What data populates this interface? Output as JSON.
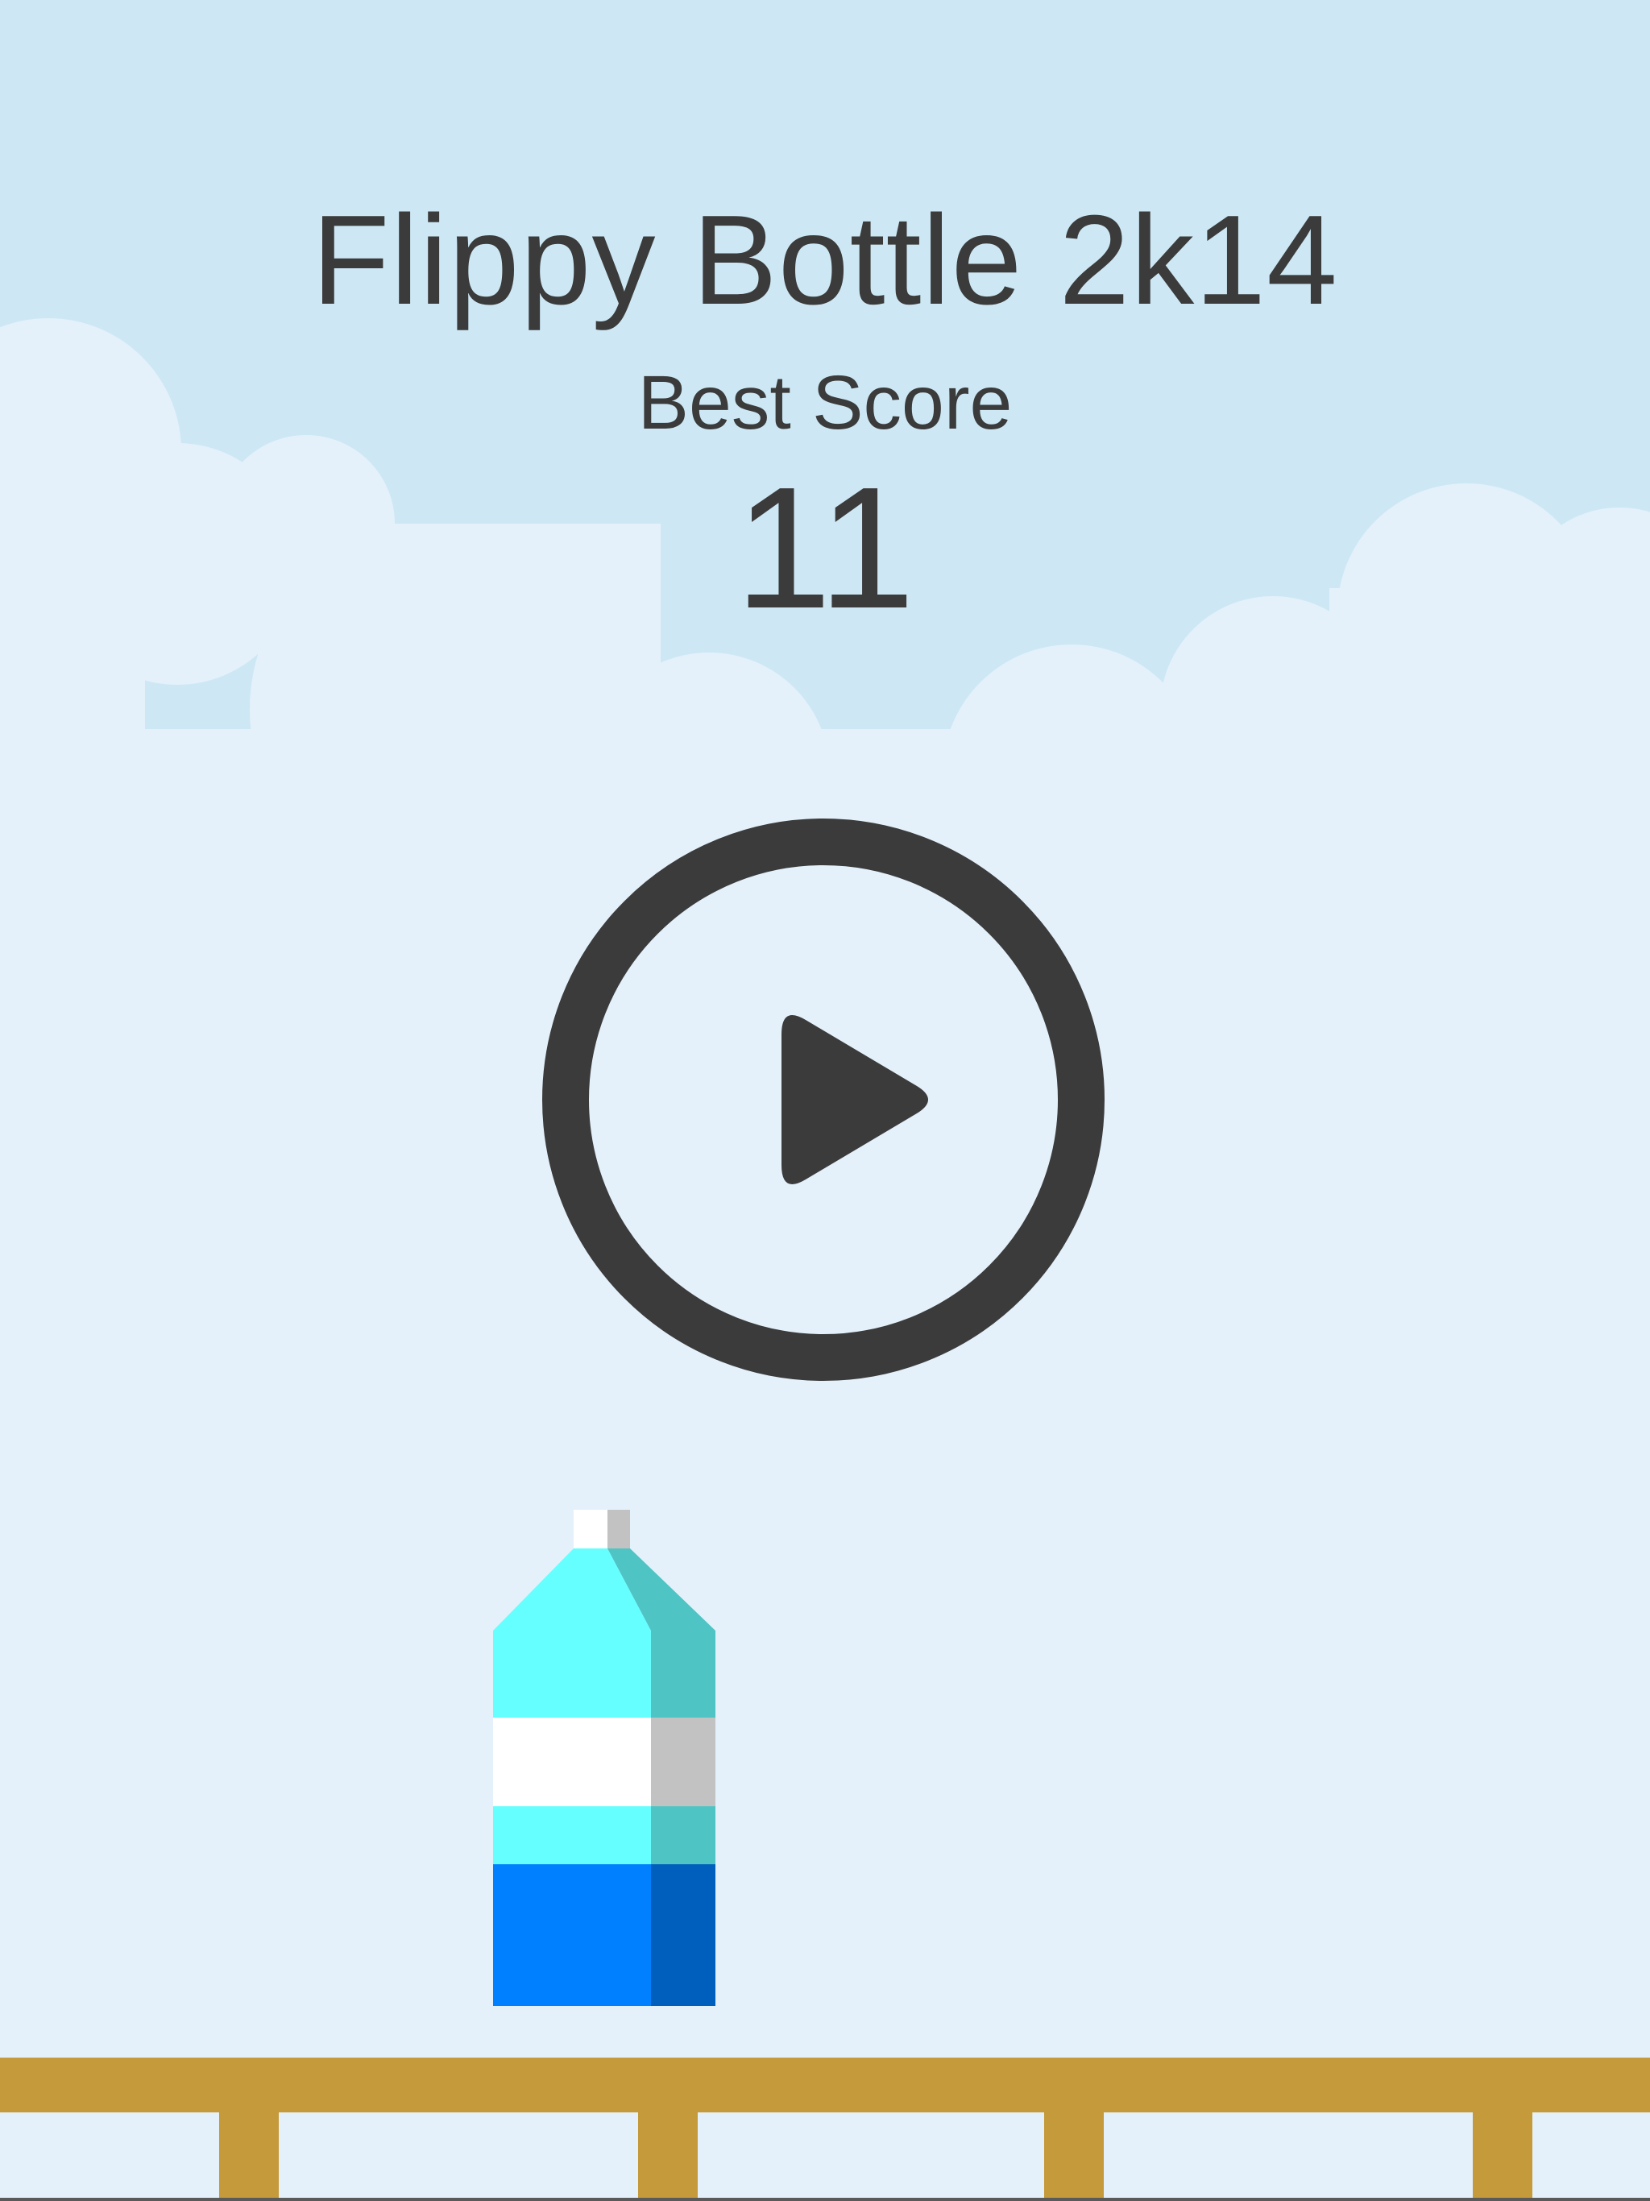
{
  "game": {
    "title": "Flippy Bottle 2k14",
    "best_score_label": "Best Score",
    "best_score_value": "11"
  },
  "controls": {
    "play_icon": "play-circle-icon"
  },
  "scene": {
    "bottle_icon": "water-bottle",
    "colors": {
      "sky": "#cde8f4",
      "cloud": "#e4f1fa",
      "text": "#3b3b3b",
      "fence": "#c49a3a",
      "bottle_cyan": "#66ffff",
      "bottle_cyan_shade": "#4fc4c4",
      "bottle_white": "#ffffff",
      "bottle_white_shade": "#c2c2c2",
      "bottle_blue": "#0080ff",
      "bottle_blue_shade": "#005fbd"
    }
  }
}
